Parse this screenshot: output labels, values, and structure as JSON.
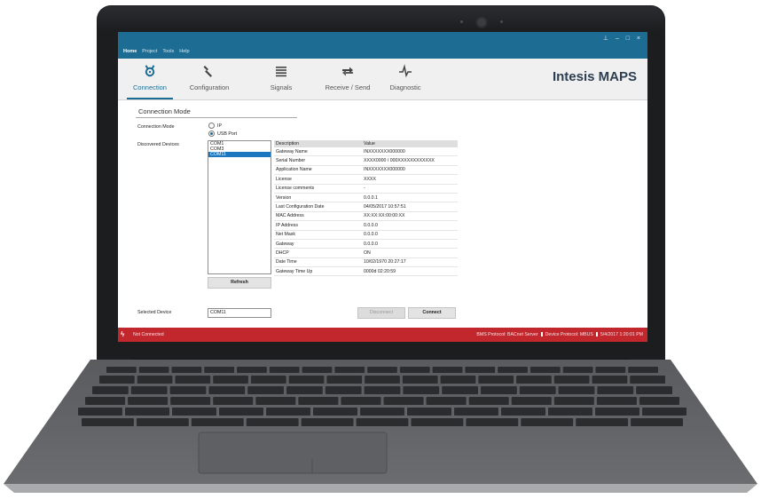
{
  "window": {
    "controls": "⊥ – □ ×",
    "menu": [
      "Home",
      "Project",
      "Tools",
      "Help"
    ]
  },
  "ribbon": {
    "tabs": [
      {
        "label": "Connection",
        "icon": "plug-icon"
      },
      {
        "label": "Configuration",
        "icon": "wrench-icon"
      },
      {
        "label": "Signals",
        "icon": "list-icon"
      },
      {
        "label": "Receive / Send",
        "icon": "transfer-icon"
      },
      {
        "label": "Diagnostic",
        "icon": "pulse-icon"
      }
    ],
    "brand": "Intesis MAPS"
  },
  "connection": {
    "section_title": "Connection Mode",
    "mode_label": "Connection Mode",
    "options": [
      "IP",
      "USB Port"
    ],
    "selected_option": "USB Port",
    "discovered_label": "Discovered Devices",
    "devices": [
      "COM1",
      "COM3",
      "COM11"
    ],
    "selected_device_index": 2,
    "refresh_label": "Refresh",
    "selected_device_label": "Selected Device",
    "selected_device_value": "COM11",
    "disconnect_label": "Disconnect",
    "connect_label": "Connect"
  },
  "properties": {
    "headers": [
      "Description",
      "Value"
    ],
    "rows": [
      [
        "Gateway Name",
        "INXXXXXXX000000"
      ],
      [
        "Serial Number",
        "XXXX0000 / 000XXXXXXXXXXXX"
      ],
      [
        "Application Name",
        "INXXXXXXX000000"
      ],
      [
        "License",
        "XXXX"
      ],
      [
        "License comments",
        "-"
      ],
      [
        "Version",
        "0.0.0.1"
      ],
      [
        "Last Configuration Date",
        "04/05/2017 10:57:51"
      ],
      [
        "MAC Address",
        "XX:XX:XX:00:00:XX"
      ],
      [
        "IP Address",
        "0.0.0.0"
      ],
      [
        "Net Mask",
        "0.0.0.0"
      ],
      [
        "Gateway",
        "0.0.0.0"
      ],
      [
        "DHCP",
        "ON"
      ],
      [
        "Date Time",
        "10/02/1970 20:27:17"
      ],
      [
        "Gateway Time Up",
        "0000d 02:20:59"
      ]
    ]
  },
  "status": {
    "icon": "not-connected-icon",
    "left": "Not Connected",
    "bms_protocol": "BMS Protocol: BACnet Server",
    "device_protocol": "Device Protocol: MBUS",
    "datetime": "5/4/2017 1:20:01 PM"
  },
  "colors": {
    "titlebar": "#1d6c93",
    "status_bar": "#c1272d",
    "selection": "#1b77bf"
  }
}
